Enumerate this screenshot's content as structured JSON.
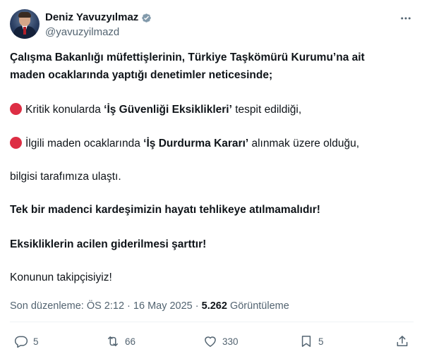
{
  "author": {
    "display_name": "Deniz Yavuzyılmaz",
    "handle": "@yavuzyilmazd"
  },
  "tweet": {
    "p1_line1": "Çalışma Bakanlığı müfettişlerinin, Türkiye Taşkömürü Kurumu’na ait",
    "p1_line2": "maden ocaklarında yaptığı denetimler neticesinde;",
    "p2_pre": "Kritik konularda ",
    "p2_bold": "‘İş Güvenliği Eksiklikleri’",
    "p2_post": " tespit edildiği,",
    "p3_pre": "İlgili maden ocaklarında ",
    "p3_bold": "‘İş Durdurma Kararı’",
    "p3_post": " alınmak üzere olduğu,",
    "p4": "bilgisi tarafımıza ulaştı.",
    "p5": "Tek bir madenci kardeşimizin hayatı tehlikeye atılmamalıdır!",
    "p6": "Eksikliklerin acilen giderilmesi şarttır!",
    "p7": "Konunun takipçisiyiz!"
  },
  "meta": {
    "edited": "Son düzenleme: ÖS 2:12 · 16 May 2025 · ",
    "views_count": "5.262",
    "views_label": " Görüntüleme"
  },
  "actions": {
    "replies": "5",
    "reposts": "66",
    "likes": "330",
    "bookmarks": "5"
  },
  "colors": {
    "verified": "#829aab",
    "red_circle": "#dd2e44",
    "secondary_text": "#536471"
  }
}
